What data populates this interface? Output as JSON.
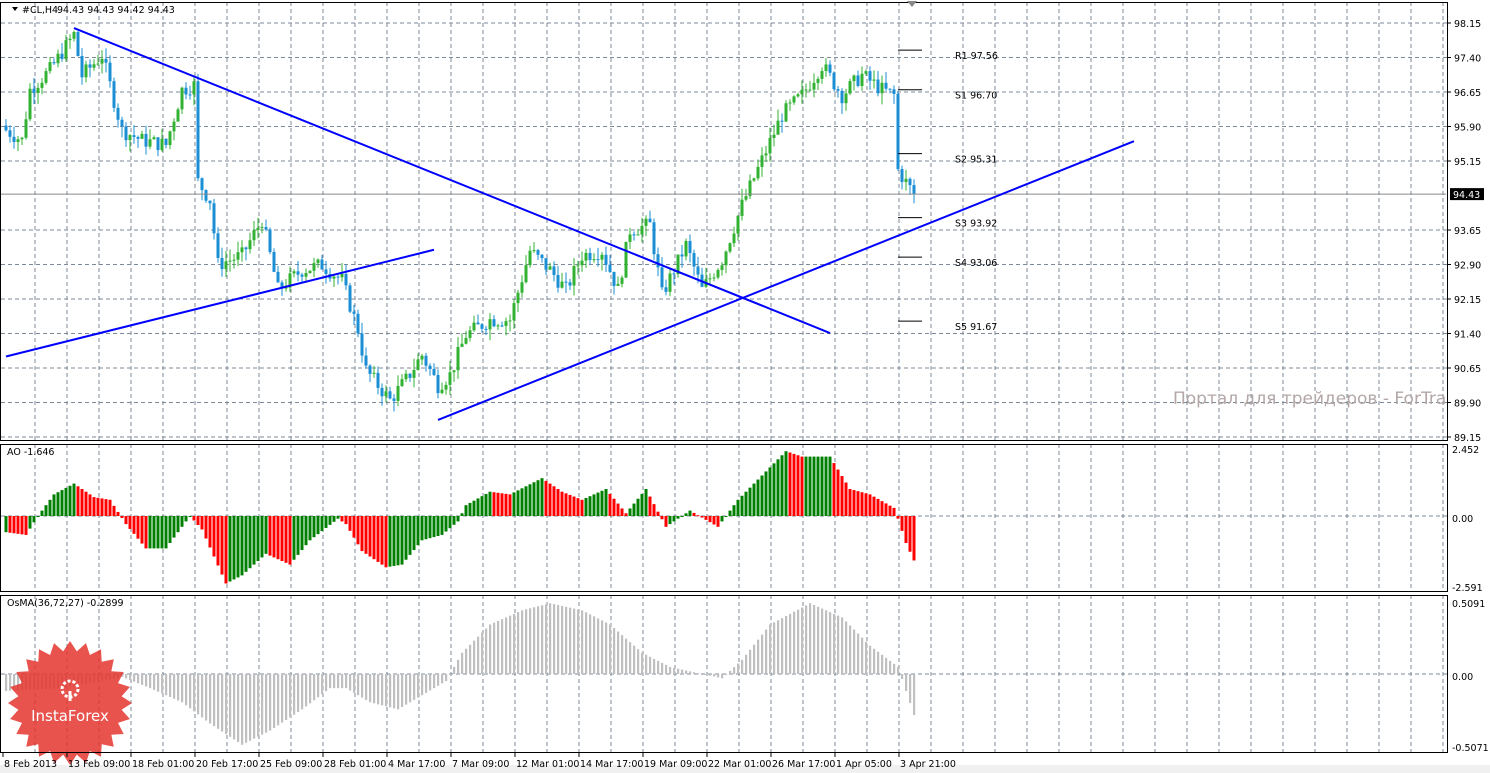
{
  "header": {
    "symbol": "#CL,H4",
    "ohlc": "94.43 94.43 94.42 94.43"
  },
  "watermark": "Портал для трейдеров - ForTrader.ru",
  "logo": {
    "text": "InstaForex"
  },
  "colors": {
    "bull": "#32b232",
    "bear": "#1a8fd6",
    "trend": "#0000ff",
    "ao_up": "#008000",
    "ao_down": "#ff0000",
    "osma": "#c0c0c0",
    "grid": "#7c8a99"
  },
  "chart_data": [
    {
      "type": "candlestick",
      "title": "#CL,H4",
      "ylim": [
        89.15,
        98.15
      ],
      "yticks": [
        "98.15",
        "97.40",
        "96.65",
        "95.90",
        "95.15",
        "93.65",
        "92.90",
        "92.15",
        "91.40",
        "90.65",
        "89.90",
        "89.15"
      ],
      "current_price": "94.43",
      "xticks": [
        "8 Feb 2013",
        "13 Feb 09:00",
        "18 Feb 01:00",
        "20 Feb 17:00",
        "25 Feb 09:00",
        "28 Feb 01:00",
        "4 Mar 17:00",
        "7 Mar 09:00",
        "12 Mar 01:00",
        "14 Mar 17:00",
        "19 Mar 09:00",
        "22 Mar 01:00",
        "26 Mar 17:00",
        "1 Apr 05:00",
        "3 Apr 21:00"
      ],
      "close_keypoints": [
        [
          0,
          95.82
        ],
        [
          4,
          95.6
        ],
        [
          6,
          96.7
        ],
        [
          11,
          97.13
        ],
        [
          17,
          97.9
        ],
        [
          19,
          97.0
        ],
        [
          24,
          97.45
        ],
        [
          29,
          95.82
        ],
        [
          34,
          95.6
        ],
        [
          40,
          95.5
        ],
        [
          44,
          96.7
        ],
        [
          47,
          96.8
        ],
        [
          48,
          94.7
        ],
        [
          51,
          94.3
        ],
        [
          53,
          92.9
        ],
        [
          59,
          93.1
        ],
        [
          64,
          93.87
        ],
        [
          68,
          92.35
        ],
        [
          74,
          92.78
        ],
        [
          79,
          92.89
        ],
        [
          84,
          92.56
        ],
        [
          88,
          91.48
        ],
        [
          90,
          90.6
        ],
        [
          96,
          89.95
        ],
        [
          100,
          90.39
        ],
        [
          104,
          90.93
        ],
        [
          108,
          90.28
        ],
        [
          111,
          90.5
        ],
        [
          115,
          91.37
        ],
        [
          121,
          91.7
        ],
        [
          126,
          91.7
        ],
        [
          131,
          93.2
        ],
        [
          136,
          92.78
        ],
        [
          140,
          92.35
        ],
        [
          144,
          93.1
        ],
        [
          149,
          93.2
        ],
        [
          153,
          92.35
        ],
        [
          156,
          93.65
        ],
        [
          161,
          93.76
        ],
        [
          164,
          92.24
        ],
        [
          170,
          93.32
        ],
        [
          174,
          92.35
        ],
        [
          179,
          93.0
        ],
        [
          184,
          94.19
        ],
        [
          189,
          95.17
        ],
        [
          194,
          96.15
        ],
        [
          199,
          96.58
        ],
        [
          204,
          97.24
        ],
        [
          209,
          96.58
        ],
        [
          214,
          97.02
        ],
        [
          219,
          96.7
        ],
        [
          222,
          96.58
        ],
        [
          223,
          94.95
        ],
        [
          227,
          94.43
        ]
      ],
      "trendlines": [
        {
          "from": [
            17,
            98.04
          ],
          "to": [
            206,
            91.41
          ]
        },
        {
          "from": [
            0,
            90.9
          ],
          "to": [
            107,
            93.22
          ]
        },
        {
          "from": [
            108,
            89.52
          ],
          "to": [
            282,
            95.58
          ]
        }
      ],
      "pivots": [
        {
          "label": "R1 97.56",
          "value": 97.56
        },
        {
          "label": "S1 96.70",
          "value": 96.7
        },
        {
          "label": "S2 95.31",
          "value": 95.31
        },
        {
          "label": "S3 93.92",
          "value": 93.92
        },
        {
          "label": "S4 93.06",
          "value": 93.06
        },
        {
          "label": "S5 91.67",
          "value": 91.67
        }
      ]
    },
    {
      "type": "bar",
      "title": "AO -1.646",
      "ylim": [
        -2.591,
        2.452
      ],
      "yticks": [
        "2.452",
        "0.00",
        "-2.591"
      ],
      "keypoints": [
        [
          0,
          -0.6
        ],
        [
          5,
          -0.7
        ],
        [
          8,
          0
        ],
        [
          12,
          0.8
        ],
        [
          17,
          1.2
        ],
        [
          22,
          0.7
        ],
        [
          26,
          0.6
        ],
        [
          30,
          -0.3
        ],
        [
          35,
          -1.2
        ],
        [
          40,
          -1.2
        ],
        [
          46,
          0
        ],
        [
          49,
          -0.5
        ],
        [
          55,
          -2.5
        ],
        [
          59,
          -2.2
        ],
        [
          65,
          -1.4
        ],
        [
          71,
          -1.8
        ],
        [
          76,
          -0.9
        ],
        [
          83,
          -0.1
        ],
        [
          85,
          -0.3
        ],
        [
          89,
          -1.3
        ],
        [
          95,
          -1.9
        ],
        [
          99,
          -1.8
        ],
        [
          104,
          -0.9
        ],
        [
          109,
          -0.7
        ],
        [
          113,
          -0.2
        ],
        [
          115,
          0.4
        ],
        [
          121,
          0.9
        ],
        [
          126,
          0.8
        ],
        [
          134,
          1.4
        ],
        [
          139,
          0.9
        ],
        [
          144,
          0.6
        ],
        [
          150,
          1.0
        ],
        [
          155,
          0.1
        ],
        [
          160,
          1.0
        ],
        [
          165,
          -0.4
        ],
        [
          171,
          0.2
        ],
        [
          178,
          -0.4
        ],
        [
          183,
          0.6
        ],
        [
          189,
          1.5
        ],
        [
          195,
          2.4
        ],
        [
          199,
          2.2
        ],
        [
          206,
          2.2
        ],
        [
          211,
          1.0
        ],
        [
          216,
          0.8
        ],
        [
          222,
          0.3
        ],
        [
          223,
          -0.1
        ],
        [
          225,
          -1.0
        ],
        [
          227,
          -1.646
        ]
      ]
    },
    {
      "type": "bar",
      "title": "OsMA(36,72,27) -0.2899",
      "ylim": [
        -0.5071,
        0.5091
      ],
      "yticks": [
        "0.5091",
        "0.00",
        "-0.5071"
      ],
      "keypoints": [
        [
          0,
          -0.12
        ],
        [
          14,
          -0.1
        ],
        [
          24,
          -0.05
        ],
        [
          29,
          -0.02
        ],
        [
          36,
          -0.1
        ],
        [
          44,
          -0.2
        ],
        [
          51,
          -0.35
        ],
        [
          59,
          -0.5
        ],
        [
          66,
          -0.4
        ],
        [
          74,
          -0.25
        ],
        [
          81,
          -0.1
        ],
        [
          85,
          -0.1
        ],
        [
          91,
          -0.2
        ],
        [
          98,
          -0.25
        ],
        [
          104,
          -0.15
        ],
        [
          110,
          -0.05
        ],
        [
          114,
          0.15
        ],
        [
          121,
          0.35
        ],
        [
          129,
          0.45
        ],
        [
          136,
          0.5
        ],
        [
          144,
          0.45
        ],
        [
          151,
          0.35
        ],
        [
          159,
          0.15
        ],
        [
          166,
          0.05
        ],
        [
          174,
          0.0
        ],
        [
          179,
          -0.03
        ],
        [
          184,
          0.1
        ],
        [
          191,
          0.35
        ],
        [
          201,
          0.5
        ],
        [
          209,
          0.4
        ],
        [
          216,
          0.2
        ],
        [
          223,
          0.05
        ],
        [
          227,
          -0.29
        ]
      ]
    }
  ]
}
